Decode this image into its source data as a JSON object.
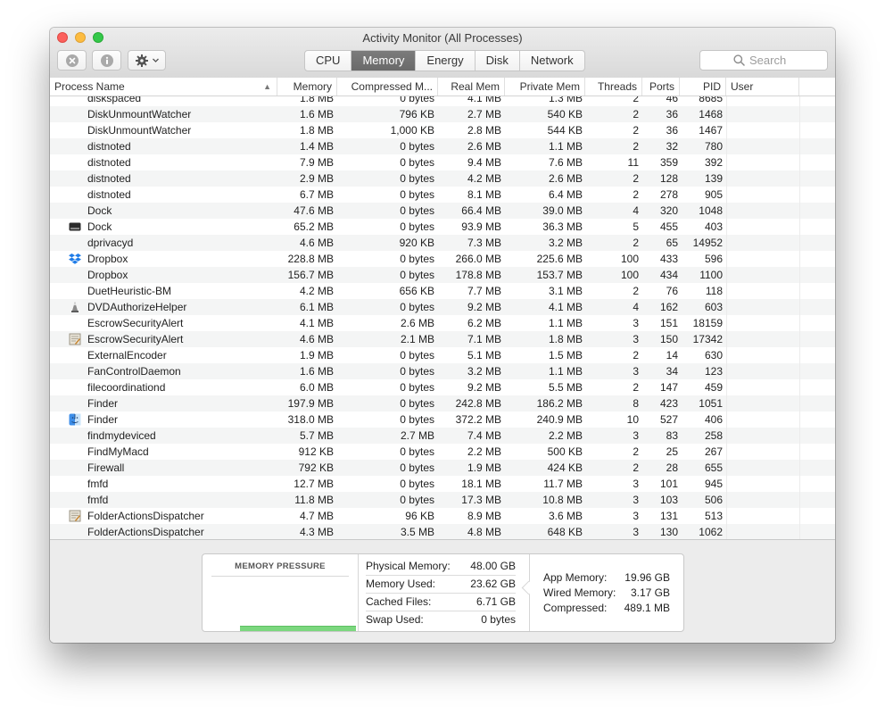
{
  "window": {
    "title": "Activity Monitor (All Processes)"
  },
  "toolbar": {
    "stop_icon": "stop-process-icon",
    "info_icon": "info-icon",
    "action_icon": "gear-icon",
    "tabs": [
      "CPU",
      "Memory",
      "Energy",
      "Disk",
      "Network"
    ],
    "active_tab": "Memory",
    "search_placeholder": "Search"
  },
  "table": {
    "columns": [
      "Process Name",
      "Memory",
      "Compressed M...",
      "Real Mem",
      "Private Mem",
      "Threads",
      "Ports",
      "PID",
      "User"
    ],
    "sort_column": "Process Name",
    "rows": [
      {
        "icon": "",
        "name": "diskspaced",
        "memory": "1.8 MB",
        "compressed": "0 bytes",
        "real": "4.1 MB",
        "private": "1.3 MB",
        "threads": "2",
        "ports": "46",
        "pid": "8685"
      },
      {
        "icon": "",
        "name": "DiskUnmountWatcher",
        "memory": "1.6 MB",
        "compressed": "796 KB",
        "real": "2.7 MB",
        "private": "540 KB",
        "threads": "2",
        "ports": "36",
        "pid": "1468"
      },
      {
        "icon": "",
        "name": "DiskUnmountWatcher",
        "memory": "1.8 MB",
        "compressed": "1,000 KB",
        "real": "2.8 MB",
        "private": "544 KB",
        "threads": "2",
        "ports": "36",
        "pid": "1467"
      },
      {
        "icon": "",
        "name": "distnoted",
        "memory": "1.4 MB",
        "compressed": "0 bytes",
        "real": "2.6 MB",
        "private": "1.1 MB",
        "threads": "2",
        "ports": "32",
        "pid": "780"
      },
      {
        "icon": "",
        "name": "distnoted",
        "memory": "7.9 MB",
        "compressed": "0 bytes",
        "real": "9.4 MB",
        "private": "7.6 MB",
        "threads": "11",
        "ports": "359",
        "pid": "392"
      },
      {
        "icon": "",
        "name": "distnoted",
        "memory": "2.9 MB",
        "compressed": "0 bytes",
        "real": "4.2 MB",
        "private": "2.6 MB",
        "threads": "2",
        "ports": "128",
        "pid": "139"
      },
      {
        "icon": "",
        "name": "distnoted",
        "memory": "6.7 MB",
        "compressed": "0 bytes",
        "real": "8.1 MB",
        "private": "6.4 MB",
        "threads": "2",
        "ports": "278",
        "pid": "905"
      },
      {
        "icon": "",
        "name": "Dock",
        "memory": "47.6 MB",
        "compressed": "0 bytes",
        "real": "66.4 MB",
        "private": "39.0 MB",
        "threads": "4",
        "ports": "320",
        "pid": "1048"
      },
      {
        "icon": "dock-app-icon",
        "name": "Dock",
        "memory": "65.2 MB",
        "compressed": "0 bytes",
        "real": "93.9 MB",
        "private": "36.3 MB",
        "threads": "5",
        "ports": "455",
        "pid": "403"
      },
      {
        "icon": "",
        "name": "dprivacyd",
        "memory": "4.6 MB",
        "compressed": "920 KB",
        "real": "7.3 MB",
        "private": "3.2 MB",
        "threads": "2",
        "ports": "65",
        "pid": "14952"
      },
      {
        "icon": "dropbox-icon",
        "name": "Dropbox",
        "memory": "228.8 MB",
        "compressed": "0 bytes",
        "real": "266.0 MB",
        "private": "225.6 MB",
        "threads": "100",
        "ports": "433",
        "pid": "596"
      },
      {
        "icon": "",
        "name": "Dropbox",
        "memory": "156.7 MB",
        "compressed": "0 bytes",
        "real": "178.8 MB",
        "private": "153.7 MB",
        "threads": "100",
        "ports": "434",
        "pid": "1100"
      },
      {
        "icon": "",
        "name": "DuetHeuristic-BM",
        "memory": "4.2 MB",
        "compressed": "656 KB",
        "real": "7.7 MB",
        "private": "3.1 MB",
        "threads": "2",
        "ports": "76",
        "pid": "118"
      },
      {
        "icon": "dvd-authorize-icon",
        "name": "DVDAuthorizeHelper",
        "memory": "6.1 MB",
        "compressed": "0 bytes",
        "real": "9.2 MB",
        "private": "4.1 MB",
        "threads": "4",
        "ports": "162",
        "pid": "603"
      },
      {
        "icon": "",
        "name": "EscrowSecurityAlert",
        "memory": "4.1 MB",
        "compressed": "2.6 MB",
        "real": "6.2 MB",
        "private": "1.1 MB",
        "threads": "3",
        "ports": "151",
        "pid": "18159"
      },
      {
        "icon": "script-app-icon",
        "name": "EscrowSecurityAlert",
        "memory": "4.6 MB",
        "compressed": "2.1 MB",
        "real": "7.1 MB",
        "private": "1.8 MB",
        "threads": "3",
        "ports": "150",
        "pid": "17342"
      },
      {
        "icon": "",
        "name": "ExternalEncoder",
        "memory": "1.9 MB",
        "compressed": "0 bytes",
        "real": "5.1 MB",
        "private": "1.5 MB",
        "threads": "2",
        "ports": "14",
        "pid": "630"
      },
      {
        "icon": "",
        "name": "FanControlDaemon",
        "memory": "1.6 MB",
        "compressed": "0 bytes",
        "real": "3.2 MB",
        "private": "1.1 MB",
        "threads": "3",
        "ports": "34",
        "pid": "123"
      },
      {
        "icon": "",
        "name": "filecoordinationd",
        "memory": "6.0 MB",
        "compressed": "0 bytes",
        "real": "9.2 MB",
        "private": "5.5 MB",
        "threads": "2",
        "ports": "147",
        "pid": "459"
      },
      {
        "icon": "",
        "name": "Finder",
        "memory": "197.9 MB",
        "compressed": "0 bytes",
        "real": "242.8 MB",
        "private": "186.2 MB",
        "threads": "8",
        "ports": "423",
        "pid": "1051"
      },
      {
        "icon": "finder-icon",
        "name": "Finder",
        "memory": "318.0 MB",
        "compressed": "0 bytes",
        "real": "372.2 MB",
        "private": "240.9 MB",
        "threads": "10",
        "ports": "527",
        "pid": "406"
      },
      {
        "icon": "",
        "name": "findmydeviced",
        "memory": "5.7 MB",
        "compressed": "2.7 MB",
        "real": "7.4 MB",
        "private": "2.2 MB",
        "threads": "3",
        "ports": "83",
        "pid": "258"
      },
      {
        "icon": "",
        "name": "FindMyMacd",
        "memory": "912 KB",
        "compressed": "0 bytes",
        "real": "2.2 MB",
        "private": "500 KB",
        "threads": "2",
        "ports": "25",
        "pid": "267"
      },
      {
        "icon": "",
        "name": "Firewall",
        "memory": "792 KB",
        "compressed": "0 bytes",
        "real": "1.9 MB",
        "private": "424 KB",
        "threads": "2",
        "ports": "28",
        "pid": "655"
      },
      {
        "icon": "",
        "name": "fmfd",
        "memory": "12.7 MB",
        "compressed": "0 bytes",
        "real": "18.1 MB",
        "private": "11.7 MB",
        "threads": "3",
        "ports": "101",
        "pid": "945"
      },
      {
        "icon": "",
        "name": "fmfd",
        "memory": "11.8 MB",
        "compressed": "0 bytes",
        "real": "17.3 MB",
        "private": "10.8 MB",
        "threads": "3",
        "ports": "103",
        "pid": "506"
      },
      {
        "icon": "script-app-icon",
        "name": "FolderActionsDispatcher",
        "memory": "4.7 MB",
        "compressed": "96 KB",
        "real": "8.9 MB",
        "private": "3.6 MB",
        "threads": "3",
        "ports": "131",
        "pid": "513"
      },
      {
        "icon": "",
        "name": "FolderActionsDispatcher",
        "memory": "4.3 MB",
        "compressed": "3.5 MB",
        "real": "4.8 MB",
        "private": "648 KB",
        "threads": "3",
        "ports": "130",
        "pid": "1062"
      }
    ]
  },
  "memory_pressure": {
    "title": "MEMORY PRESSURE",
    "level": 0.95,
    "bar_color": "#7bd77e"
  },
  "stats": [
    {
      "label": "Physical Memory:",
      "value": "48.00 GB"
    },
    {
      "label": "Memory Used:",
      "value": "23.62 GB"
    },
    {
      "label": "Cached Files:",
      "value": "6.71 GB"
    },
    {
      "label": "Swap Used:",
      "value": "0 bytes"
    }
  ],
  "stats_detail": [
    {
      "label": "App Memory:",
      "value": "19.96 GB"
    },
    {
      "label": "Wired Memory:",
      "value": "3.17 GB"
    },
    {
      "label": "Compressed:",
      "value": "489.1 MB"
    }
  ]
}
